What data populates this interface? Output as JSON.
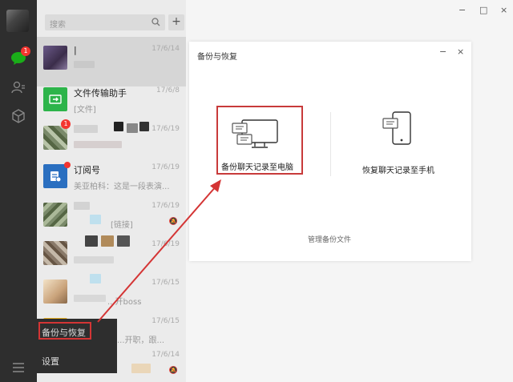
{
  "sidebar": {
    "chat_badge": "1"
  },
  "search": {
    "placeholder": "搜索",
    "add": "+"
  },
  "conversations": [
    {
      "name": "|",
      "message": "",
      "time": "17/6/14",
      "badge": ""
    },
    {
      "name": "文件传输助手",
      "message": "[文件]",
      "time": "17/6/8",
      "badge": ""
    },
    {
      "name": "",
      "message": "",
      "time": "17/6/19",
      "badge": "1"
    },
    {
      "name": "订阅号",
      "message": "美亚柏科：这是一段表演...",
      "time": "17/6/19",
      "badge": ""
    },
    {
      "name": "",
      "message": "[链接]",
      "time": "17/6/19",
      "badge": ""
    },
    {
      "name": "",
      "message": "",
      "time": "17/6/19",
      "badge": ""
    },
    {
      "name": "",
      "message": "...开boss",
      "time": "17/6/15",
      "badge": ""
    },
    {
      "name": "...",
      "message": "...开职，跟...",
      "time": "17/6/15",
      "badge": ""
    },
    {
      "name": "",
      "message": "",
      "time": "17/6/14",
      "badge": ""
    }
  ],
  "popup_menu": {
    "backup": "备份与恢复",
    "settings": "设置"
  },
  "window_controls": {
    "minimize": "−",
    "maximize": "□",
    "close": "×"
  },
  "dialog": {
    "title": "备份与恢复",
    "minimize": "−",
    "close": "×",
    "backup_to_pc": "备份聊天记录至电脑",
    "restore_to_phone": "恢复聊天记录至手机",
    "manage_files": "管理备份文件"
  },
  "colors": {
    "sidebar_bg": "#2e2e2e",
    "list_bg": "#ebebeb",
    "badge": "#f43530",
    "highlight_border": "#c83a3a",
    "annotation_arrow": "#d43535"
  }
}
